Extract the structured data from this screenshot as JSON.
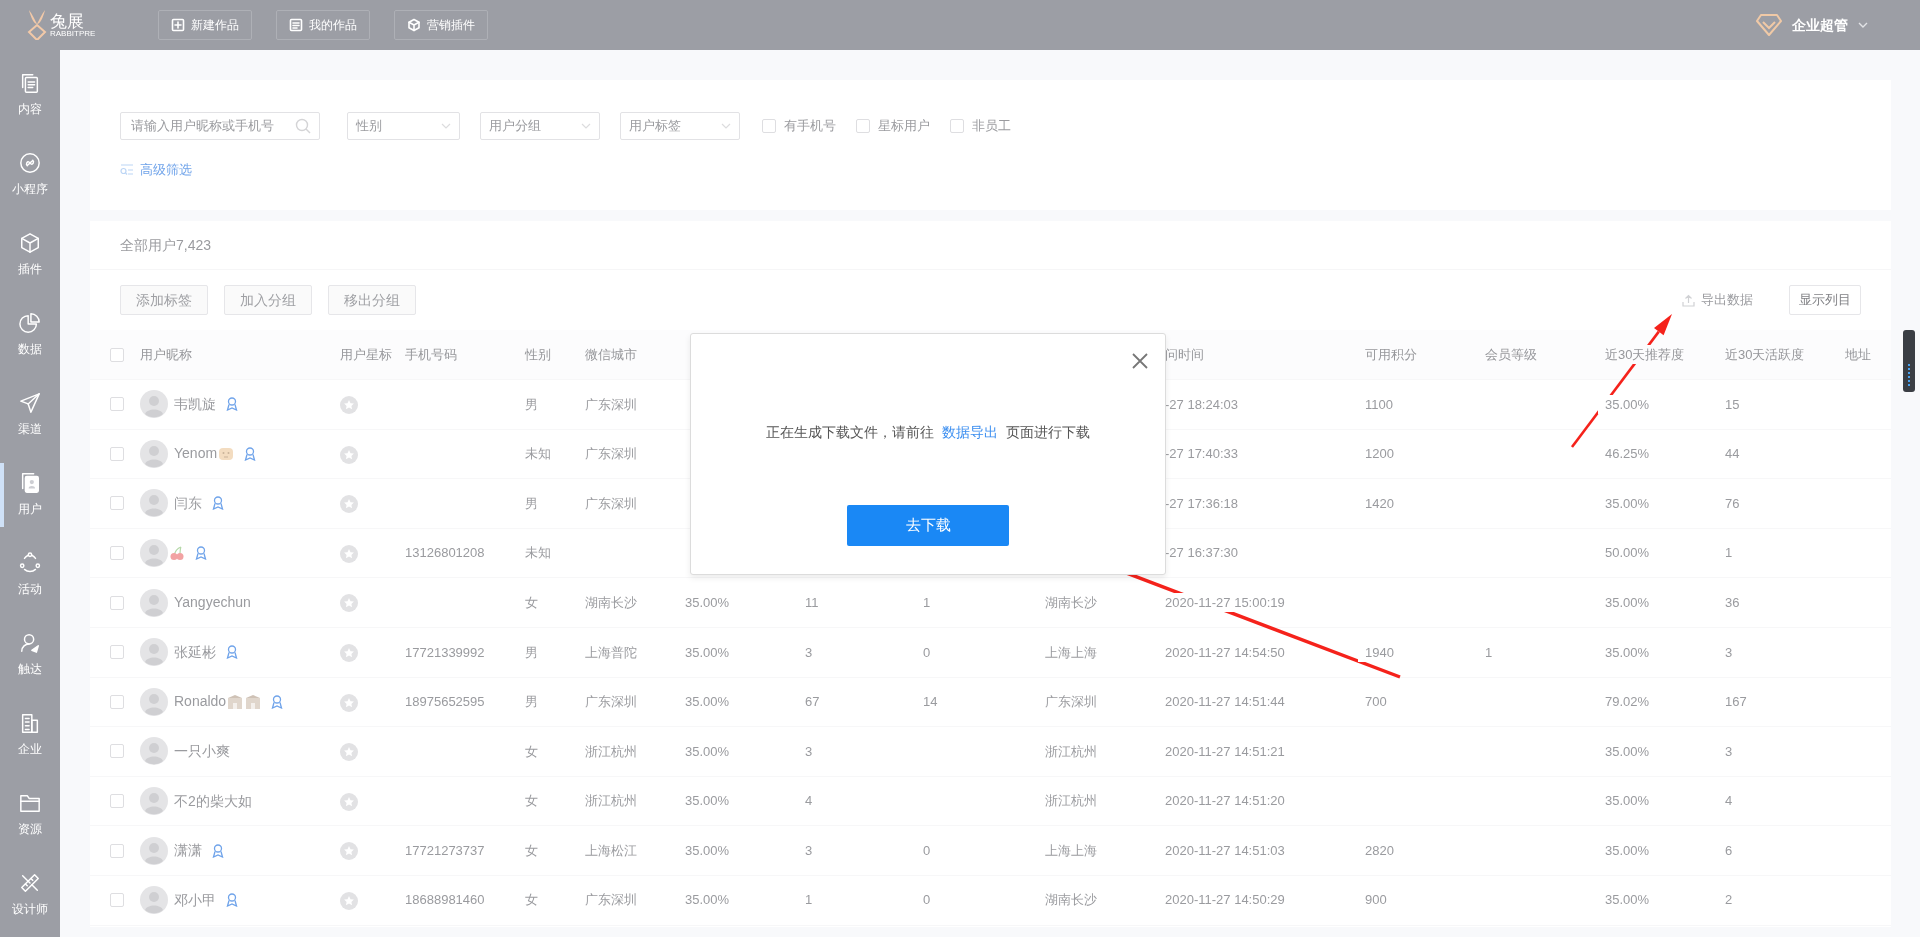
{
  "topbar": {
    "logo": {
      "name": "兔展",
      "subtitle": "RABBITPRE"
    },
    "nav_buttons": [
      {
        "kind": "plus",
        "label": "新建作品"
      },
      {
        "kind": "list",
        "label": "我的作品"
      },
      {
        "kind": "cube",
        "label": "营销插件"
      }
    ],
    "account": {
      "label": "企业超管"
    }
  },
  "sidebar": {
    "items": [
      {
        "kind": "pages",
        "label": "内容",
        "selected": false
      },
      {
        "kind": "link",
        "label": "小程序",
        "selected": false
      },
      {
        "kind": "cube",
        "label": "插件",
        "selected": false
      },
      {
        "kind": "pie",
        "label": "数据",
        "selected": false
      },
      {
        "kind": "plane",
        "label": "渠道",
        "selected": false
      },
      {
        "kind": "contact",
        "label": "用户",
        "selected": true
      },
      {
        "kind": "dots",
        "label": "活动",
        "selected": false
      },
      {
        "kind": "reach",
        "label": "触达",
        "selected": false
      },
      {
        "kind": "building",
        "label": "企业",
        "selected": false
      },
      {
        "kind": "folder",
        "label": "资源",
        "selected": false
      },
      {
        "kind": "tools",
        "label": "设计师",
        "selected": false
      }
    ]
  },
  "filters": {
    "search": {
      "placeholder": "请输入用户昵称或手机号"
    },
    "selects": [
      {
        "placeholder": "性别"
      },
      {
        "placeholder": "用户分组"
      },
      {
        "placeholder": "用户标签"
      }
    ],
    "checkboxes": [
      {
        "label": "有手机号",
        "checked": false
      },
      {
        "label": "星标用户",
        "checked": false
      },
      {
        "label": "非员工",
        "checked": false
      }
    ],
    "advanced_link": "高级筛选"
  },
  "users": {
    "total": "全部用户7,423",
    "actions": [
      {
        "label": "添加标签",
        "disabled": true
      },
      {
        "label": "加入分组",
        "disabled": true
      },
      {
        "label": "移出分组",
        "disabled": true
      }
    ],
    "export_link": "导出数据",
    "columns_button": "显示列目",
    "table": {
      "select_all": {
        "checked": false
      },
      "columns": [
        {
          "label": "用户昵称"
        },
        {
          "label": "用户星标"
        },
        {
          "label": "手机号码"
        },
        {
          "label": "性别"
        },
        {
          "label": "微信城市"
        },
        null,
        null,
        null,
        null,
        {
          "label": "问时间"
        },
        {
          "label": "可用积分"
        },
        {
          "label": "会员等级"
        },
        {
          "label": "近30天推荐度"
        },
        {
          "label": "近30天活跃度"
        },
        {
          "label": "地址"
        }
      ],
      "rows": [
        {
          "checked": false,
          "cells": [
            {
              "name": "韦凯旋",
              "verified": true
            },
            {
              "starred": false
            },
            null,
            "男",
            "广东深圳",
            null,
            null,
            null,
            null,
            "-27 18:24:03",
            "1100",
            null,
            "35.00%",
            "15",
            null
          ]
        },
        {
          "checked": false,
          "cells": [
            {
              "name": "Yenom",
              "emoji": [
                {
                  "kind": "tiger"
                }
              ],
              "verified": true
            },
            {
              "starred": false
            },
            null,
            "未知",
            "广东深圳",
            null,
            null,
            null,
            null,
            "-27 17:40:33",
            "1200",
            null,
            "46.25%",
            "44",
            null
          ]
        },
        {
          "checked": false,
          "cells": [
            {
              "name": "闫东",
              "verified": true
            },
            {
              "starred": false
            },
            null,
            "男",
            "广东深圳",
            null,
            null,
            null,
            null,
            "-27 17:36:18",
            "1420",
            null,
            "35.00%",
            "76",
            null
          ]
        },
        {
          "checked": false,
          "cells": [
            {
              "emoji": [
                {
                  "kind": "cherry"
                }
              ],
              "verified": true
            },
            {
              "starred": false
            },
            "13126801208",
            "未知",
            null,
            null,
            null,
            null,
            null,
            "-27 16:37:30",
            null,
            null,
            "50.00%",
            "1",
            null
          ]
        },
        {
          "checked": false,
          "cells": [
            {
              "name": "Yangyechun",
              "verified": false
            },
            {
              "starred": false
            },
            null,
            "女",
            "湖南长沙",
            "35.00%",
            "11",
            "1",
            "湖南长沙",
            "2020-11-27 15:00:19",
            null,
            null,
            "35.00%",
            "36",
            null
          ]
        },
        {
          "checked": false,
          "cells": [
            {
              "name": "张延彬",
              "verified": true
            },
            {
              "starred": false
            },
            "17721339992",
            "男",
            "上海普陀",
            "35.00%",
            "3",
            "0",
            "上海上海",
            "2020-11-27 14:54:50",
            "1940",
            "1",
            "35.00%",
            "3",
            null
          ]
        },
        {
          "checked": false,
          "cells": [
            {
              "name": "Ronaldo",
              "emoji": [
                {
                  "kind": "building"
                },
                {
                  "kind": "building"
                }
              ],
              "verified": true
            },
            {
              "starred": false
            },
            "18975652595",
            "男",
            "广东深圳",
            "35.00%",
            "67",
            "14",
            "广东深圳",
            "2020-11-27 14:51:44",
            "700",
            null,
            "79.02%",
            "167",
            null
          ]
        },
        {
          "checked": false,
          "cells": [
            {
              "name": "一只小爽",
              "verified": false
            },
            {
              "starred": false
            },
            null,
            "女",
            "浙江杭州",
            "35.00%",
            "3",
            null,
            "浙江杭州",
            "2020-11-27 14:51:21",
            null,
            null,
            "35.00%",
            "3",
            null
          ]
        },
        {
          "checked": false,
          "cells": [
            {
              "name": "不2的柴大如",
              "verified": false
            },
            {
              "starred": false
            },
            null,
            "女",
            "浙江杭州",
            "35.00%",
            "4",
            null,
            "浙江杭州",
            "2020-11-27 14:51:20",
            null,
            null,
            "35.00%",
            "4",
            null
          ]
        },
        {
          "checked": false,
          "cells": [
            {
              "name": "潇潇",
              "verified": true
            },
            {
              "starred": false
            },
            "17721273737",
            "女",
            "上海松江",
            "35.00%",
            "3",
            "0",
            "上海上海",
            "2020-11-27 14:51:03",
            "2820",
            null,
            "35.00%",
            "6",
            null
          ]
        },
        {
          "checked": false,
          "cells": [
            {
              "name": "邓小甲",
              "verified": true
            },
            {
              "starred": false
            },
            "18688981460",
            "女",
            "广东深圳",
            "35.00%",
            "1",
            "0",
            "湖南长沙",
            "2020-11-27 14:50:29",
            "900",
            null,
            "35.00%",
            "2",
            null
          ]
        }
      ]
    }
  },
  "dialog": {
    "message_before": "正在生成下载文件，请前往",
    "link": "数据导出",
    "message_after": "页面进行下载",
    "button": "去下载"
  }
}
